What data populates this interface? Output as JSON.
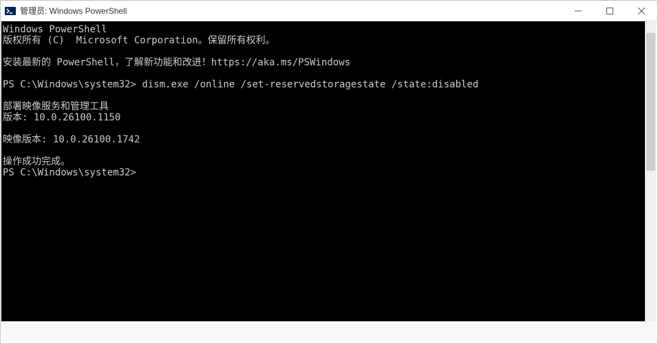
{
  "window": {
    "title": "管理员: Windows PowerShell"
  },
  "terminal": {
    "header_line1": "Windows PowerShell",
    "header_line2": "版权所有 (C)  Microsoft Corporation。保留所有权利。",
    "install_hint": "安装最新的 PowerShell，了解新功能和改进！https://aka.ms/PSWindows",
    "prompt_prefix": "PS C:\\Windows\\system32>",
    "command_entered": "dism.exe /online /set-reservedstoragestate /state:disabled",
    "dism_title": "部署映像服务和管理工具",
    "dism_version": "版本: 10.0.26100.1150",
    "image_version": "映像版本: 10.0.26100.1742",
    "success_msg": "操作成功完成。",
    "prompt_prefix2": "PS C:\\Windows\\system32>"
  }
}
